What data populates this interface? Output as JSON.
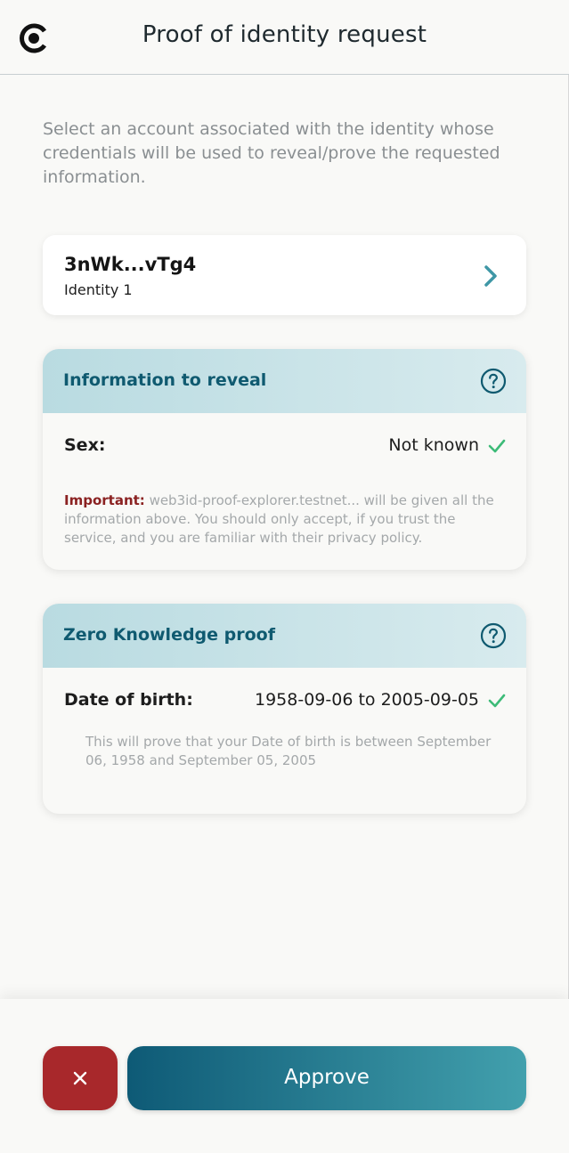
{
  "header": {
    "title": "Proof of identity request",
    "logo_icon": "concordium-logo-icon"
  },
  "intro": {
    "text": "Select an account associated with the identity whose credentials will be used to reveal/prove the requested information."
  },
  "account": {
    "address": "3nWk...vTg4",
    "identity": "Identity 1",
    "chevron_icon": "chevron-right-icon"
  },
  "reveal_section": {
    "title": "Information to reveal",
    "help_icon": "help-circle-icon",
    "attributes": [
      {
        "label": "Sex:",
        "value": "Not known",
        "status_icon": "check-icon"
      }
    ],
    "notice_important": "Important:",
    "notice_text": " web3id-proof-explorer.testnet... will be given all the information above. You should only accept, if you trust the service, and you are familiar with their privacy policy."
  },
  "zkp_section": {
    "title": "Zero Knowledge proof",
    "help_icon": "help-circle-icon",
    "attributes": [
      {
        "label": "Date of birth:",
        "value": "1958-09-06 to 2005-09-05",
        "status_icon": "check-icon"
      }
    ],
    "description": "This will prove that your Date of birth is between September 06, 1958 and September 05, 2005"
  },
  "footer": {
    "reject_icon": "close-icon",
    "approve_label": "Approve"
  },
  "colors": {
    "accent": "#0f5a70",
    "reject": "#a8282b",
    "check": "#3dbb78",
    "important": "#8b2222"
  }
}
